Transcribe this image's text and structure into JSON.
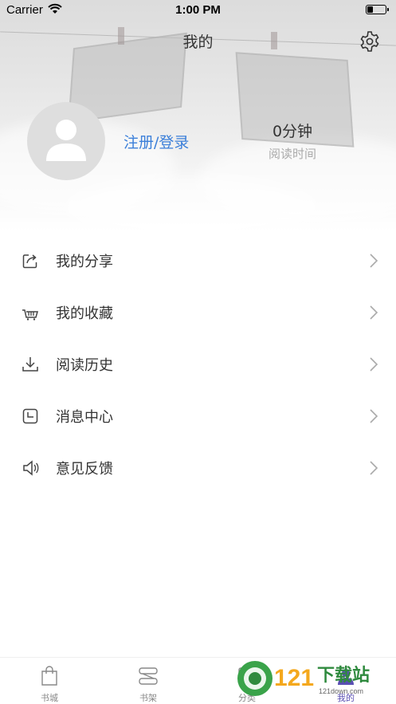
{
  "status_bar": {
    "carrier": "Carrier",
    "time": "1:00 PM"
  },
  "nav": {
    "title": "我的",
    "settings_icon": "gear-icon"
  },
  "profile": {
    "login_label": "注册/登录",
    "read_time_value": "0分钟",
    "read_time_label": "阅读时间"
  },
  "menu": {
    "items": [
      {
        "label": "我的分享",
        "icon": "share-icon"
      },
      {
        "label": "我的收藏",
        "icon": "basket-icon"
      },
      {
        "label": "阅读历史",
        "icon": "download-icon"
      },
      {
        "label": "消息中心",
        "icon": "message-icon"
      },
      {
        "label": "意见反馈",
        "icon": "speaker-icon"
      }
    ]
  },
  "tabbar": {
    "tabs": [
      {
        "label": "书城",
        "icon": "shopping-bag-icon"
      },
      {
        "label": "书架",
        "icon": "bookshelf-icon"
      },
      {
        "label": "分类",
        "icon": "category-icon"
      },
      {
        "label": "我的",
        "icon": "profile-icon"
      }
    ],
    "active_color": "#5a4fb3"
  },
  "watermark": {
    "number": "121",
    "text": "下载站",
    "url": "121down.com"
  },
  "colors": {
    "accent": "#3b7fd9",
    "text": "#333333",
    "muted": "#aaaaaa"
  }
}
